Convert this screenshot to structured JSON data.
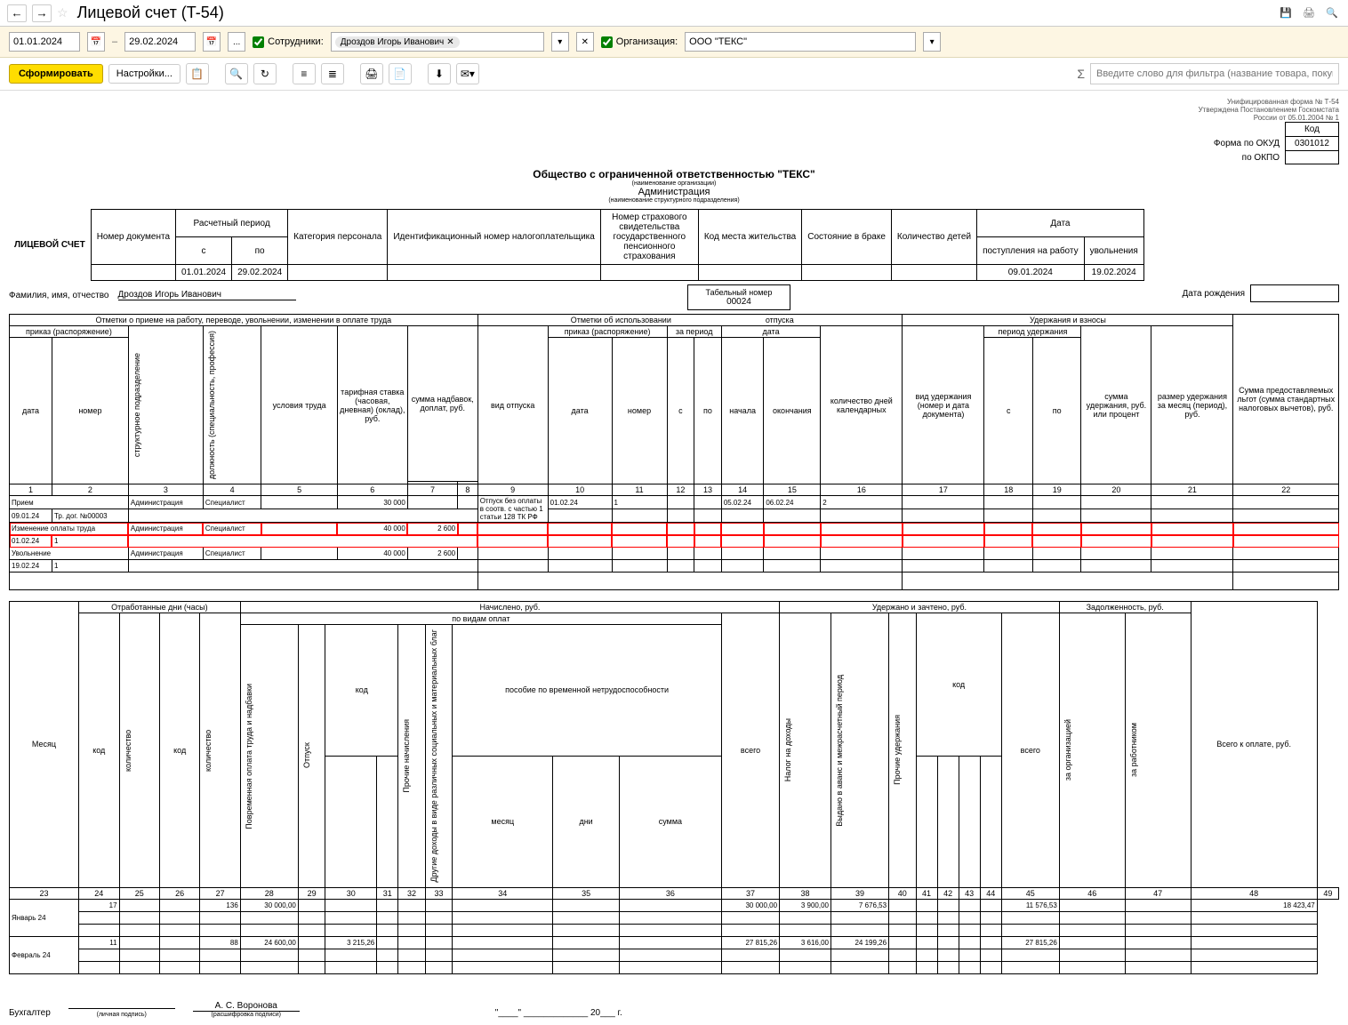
{
  "header": {
    "title": "Лицевой счет (T-54)"
  },
  "filters": {
    "date_from": "01.01.2024",
    "date_to": "29.02.2024",
    "employees_label": "Сотрудники:",
    "employee_tag": "Дроздов Игорь Иванович",
    "org_label": "Организация:",
    "org_value": "ООО \"ТЕКС\""
  },
  "actions": {
    "generate": "Сформировать",
    "settings": "Настройки...",
    "filter_placeholder": "Введите слово для фильтра (название товара, покупателя и"
  },
  "report": {
    "form_meta1": "Унифицированная форма № Т-54",
    "form_meta2": "Утверждена Постановлением Госкомстата",
    "form_meta3": "России от 05.01.2004 № 1",
    "kod_label": "Код",
    "okud_label": "Форма по ОКУД",
    "okud_value": "0301012",
    "okpo_label": "по ОКПО",
    "org_full": "Общество с ограниченной ответственностью \"ТЕКС\"",
    "org_caption": "(наименование организации)",
    "dept": "Администрация",
    "dept_caption": "(наименование структурного подразделения)",
    "doc_num_label": "Номер документа",
    "period_label": "Расчетный период",
    "period_from_label": "с",
    "period_to_label": "по",
    "period_from": "01.01.2024",
    "period_to": "29.02.2024",
    "cat_label": "Категория персонала",
    "inn_label": "Идентификационный номер налогоплательщика",
    "pension_label": "Номер страхового свидетельства государственного пенсионного страхования",
    "residence_label": "Код места жительства",
    "marital_label": "Состояние в браке",
    "children_label": "Количество детей",
    "date_label": "Дата",
    "hire_label": "поступления на работу",
    "fire_label": "увольнения",
    "hire_date": "09.01.2024",
    "fire_date": "19.02.2024",
    "big_title": "ЛИЦЕВОЙ СЧЕТ",
    "tab_num_label": "Табельный номер",
    "tab_num": "00024",
    "birth_label": "Дата рождения",
    "fio_label": "Фамилия, имя, отчество",
    "fio_value": "Дроздов Игорь Иванович",
    "accountant_label": "Бухгалтер",
    "sig_caption1": "(личная подпись)",
    "accountant_name": "А. С. Воронова",
    "sig_caption2": "(расшифровка подписи)",
    "date_quotes": "\"____\" _____________ 20___ г."
  },
  "sec1_headers": {
    "h1": "Отметки о приеме на работу, переводе, увольнении, изменении в оплате труда",
    "h2": "Отметки об использовании",
    "h2b": "отпуска",
    "h3": "Удержания и взносы",
    "h4": "Сумма предоставляемых льгот (сумма стандартных налоговых вычетов), руб.",
    "order_label": "приказ (распоряжение)",
    "date_label": "дата",
    "num_label": "номер",
    "dept_label": "структурное подразделение",
    "pos_label": "должность (специальность, профессия)",
    "cond_label": "условия труда",
    "rate_label": "тарифная ставка (часовая, дневная) (оклад), руб.",
    "bonus_label": "сумма надбавок, доплат, руб.",
    "vac_type_label": "вид отпуска",
    "period_label": "за период",
    "from_label": "с",
    "to_label": "по",
    "d_label": "дата",
    "start_label": "начала",
    "end_label": "окончания",
    "days_label": "количество дней календарных",
    "ded_type_label": "вид удержания (номер и дата документа)",
    "ded_period_label": "период удержания",
    "ded_sum_label": "сумма удержания, руб. или процент",
    "ded_month_label": "размер удержания за месяц (период), руб."
  },
  "sec1_rows": [
    {
      "type": "Прием",
      "dept": "Администрация",
      "pos": "Специалист",
      "rate": "30 000"
    },
    {
      "date": "09.01.24",
      "num": "Тр. дог. №00003"
    },
    {
      "type": "Изменение оплаты труда",
      "dept": "Администрация",
      "pos": "Специалист",
      "rate": "40 000",
      "bonus": "2 600",
      "red": true
    },
    {
      "date": "01.02.24",
      "num": "1",
      "red": true
    },
    {
      "type": "Увольнение",
      "dept": "Администрация",
      "pos": "Специалист",
      "rate": "40 000",
      "bonus": "2 600"
    },
    {
      "date": "19.02.24",
      "num": "1"
    }
  ],
  "vac_rows": [
    {
      "type": "Отпуск без оплаты в соотв. с частью 1 статьи 128 ТК РФ",
      "odate": "01.02.24",
      "onum": "1",
      "start": "05.02.24",
      "end": "06.02.24",
      "days": "2"
    }
  ],
  "sec2_headers": {
    "month": "Месяц",
    "worked": "Отработанные дни (часы)",
    "accrued": "Начислено, руб.",
    "by_type": "по видам оплат",
    "withheld": "Удержано и зачтено, руб.",
    "debt": "Задолженность, руб.",
    "code": "код",
    "qty": "количество",
    "time_pay": "Повременная оплата труда и надбавки",
    "vacation": "Отпуск",
    "other_acc": "Прочие начисления",
    "other_inc": "Другие доходы в виде различных социальных и материальных благ",
    "sick": "пособие по временной нетрудоспособности",
    "month_s": "месяц",
    "days_s": "дни",
    "sum_s": "сумма",
    "total": "всего",
    "tax": "Налог на доходы",
    "advance": "Выдано в аванс и межрасчетный период",
    "other_ded": "Прочие удержания",
    "by_org": "за организацией",
    "by_emp": "за работником",
    "total_pay": "Всего к оплате, руб."
  },
  "sec2_nums": [
    "23",
    "24",
    "25",
    "26",
    "27",
    "28",
    "29",
    "30",
    "31",
    "32",
    "33",
    "34",
    "35",
    "36",
    "37",
    "38",
    "39",
    "40",
    "41",
    "42",
    "43",
    "44",
    "45",
    "46",
    "47",
    "48",
    "49"
  ],
  "sec2_data": [
    {
      "m": "Январь 24",
      "c24": "17",
      "c27": "136",
      "c28": "30 000,00",
      "c37": "30 000,00",
      "c38": "3 900,00",
      "c39": "7 676,53",
      "c46": "11 576,53",
      "c49": "18 423,47"
    },
    {
      "m": "Февраль 24",
      "c24": "11",
      "c27": "88",
      "c28": "24 600,00",
      "c30": "3 215,26",
      "c37": "27 815,26",
      "c38": "3 616,00",
      "c39": "24 199,26",
      "c46": "27 815,26"
    }
  ]
}
